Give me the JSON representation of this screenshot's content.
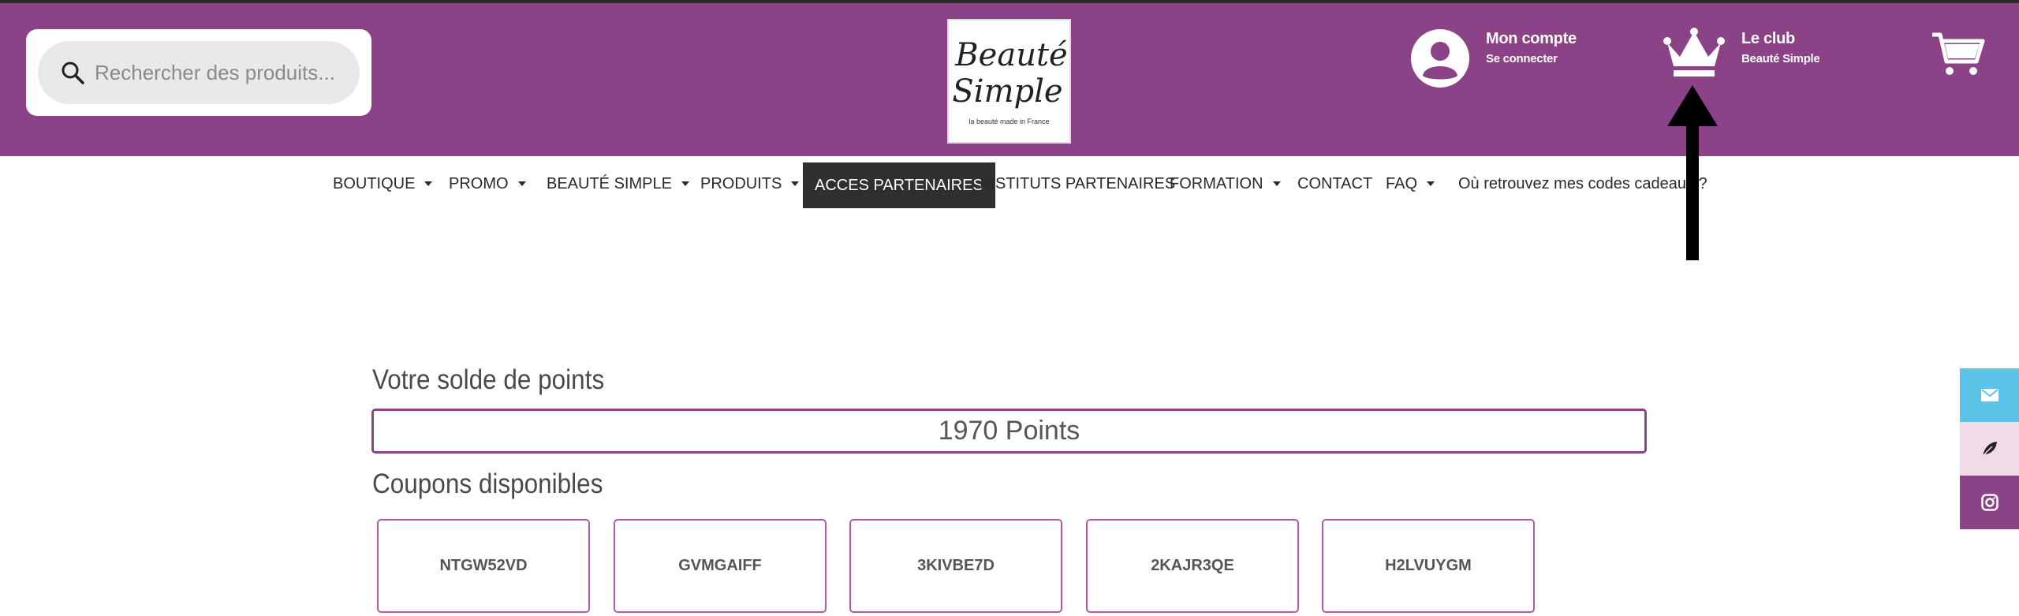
{
  "search": {
    "placeholder": "Rechercher des produits..."
  },
  "logo": {
    "line1": "Beauté",
    "line2": "Simple",
    "tagline": "la beauté made in France"
  },
  "account": {
    "title": "Mon compte",
    "subtitle": "Se connecter"
  },
  "club": {
    "title": "Le club",
    "subtitle": "Beauté Simple"
  },
  "nav": {
    "items": [
      {
        "label": "BOUTIQUE"
      },
      {
        "label": "PROMO"
      },
      {
        "label": "BEAUTÉ SIMPLE"
      },
      {
        "label": "PRODUITS"
      },
      {
        "label": "ACCES PARTENAIRES"
      },
      {
        "label": "INSTITUTS PARTENAIRES"
      },
      {
        "label": "FORMATION"
      },
      {
        "label": "CONTACT"
      },
      {
        "label": "FAQ"
      },
      {
        "label": "Où retrouvez mes codes cadeaux ?"
      }
    ]
  },
  "points": {
    "title": "Votre solde de points",
    "value": "1970 Points"
  },
  "coupons": {
    "title": "Coupons disponibles",
    "codes": [
      "NTGW52VD",
      "GVMGAIFF",
      "3KIVBE7D",
      "2KAJR3QE",
      "H2LVUYGM"
    ]
  },
  "colors": {
    "brand": "#8c4286",
    "mail": "#5bc4e8",
    "leaf": "#f1dbe8",
    "active_nav": "#2f2f2f"
  },
  "icons": [
    "search-icon",
    "account-icon",
    "crown-icon",
    "cart-icon",
    "mail-icon",
    "leaf-icon",
    "instagram-icon",
    "arrow-annotation"
  ]
}
